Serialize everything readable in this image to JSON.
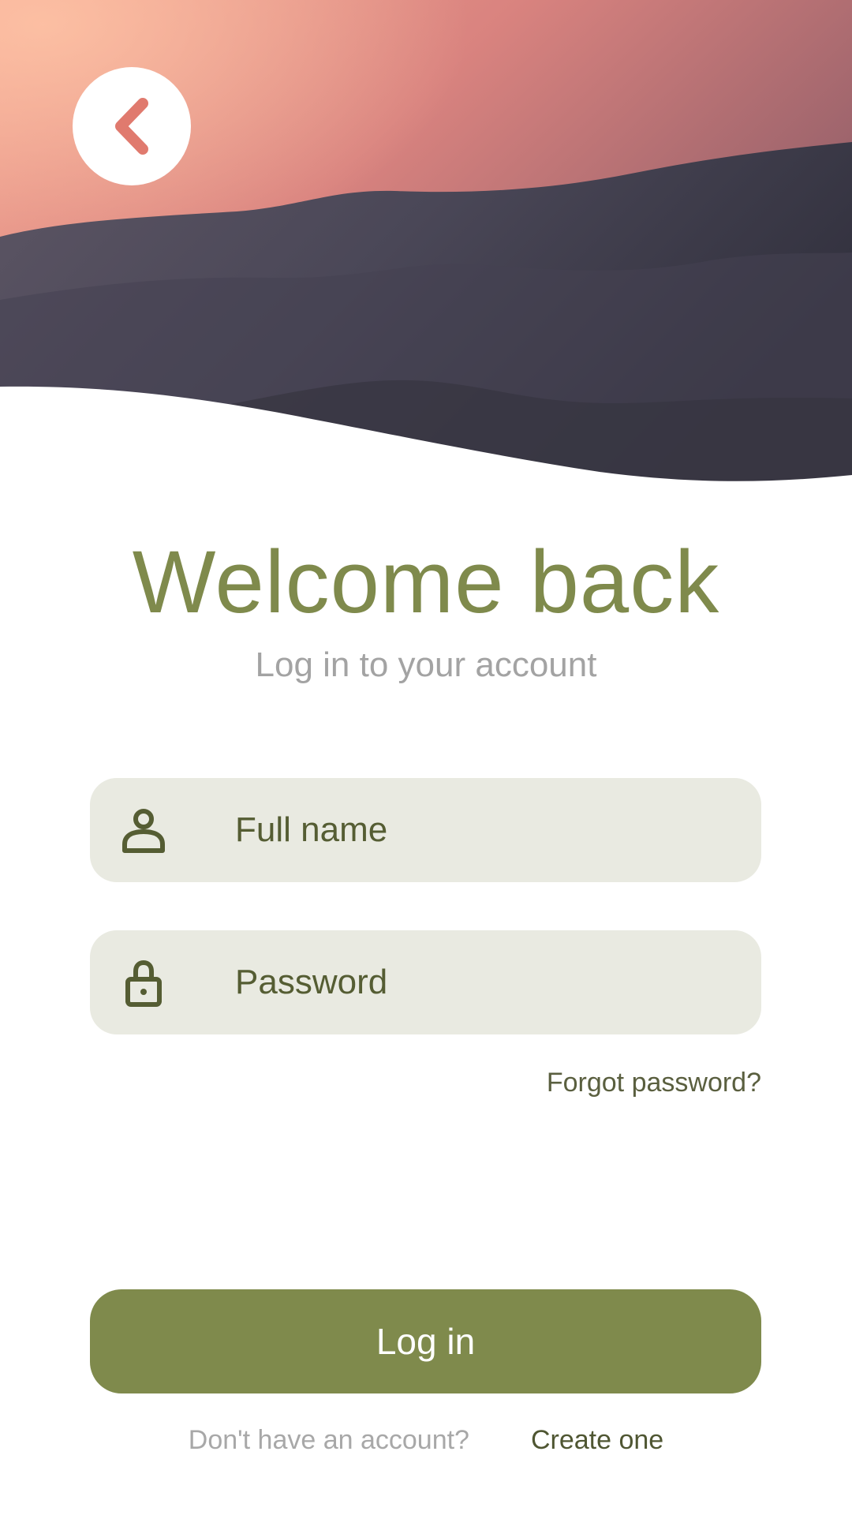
{
  "header": {
    "back_icon": "chevron-left-icon",
    "back_icon_color": "#e07a6e",
    "hero_colors": {
      "sky_top": "#e9958a",
      "sky_mid": "#b86d73",
      "cloud_dark": "#3e3c4c"
    }
  },
  "main": {
    "title": "Welcome back",
    "subtitle": "Log in to your account",
    "fields": {
      "name": {
        "icon": "user-icon",
        "placeholder": "Full name",
        "value": ""
      },
      "password": {
        "icon": "lock-icon",
        "placeholder": "Password",
        "value": ""
      }
    },
    "forgot_label": "Forgot password?",
    "login_label": "Log in"
  },
  "footer": {
    "prompt": "Don't have an account?",
    "create_label": "Create one"
  },
  "colors": {
    "accent": "#7f8a4c",
    "field_bg": "#e9eae1",
    "muted_text": "#a3a3a3"
  }
}
